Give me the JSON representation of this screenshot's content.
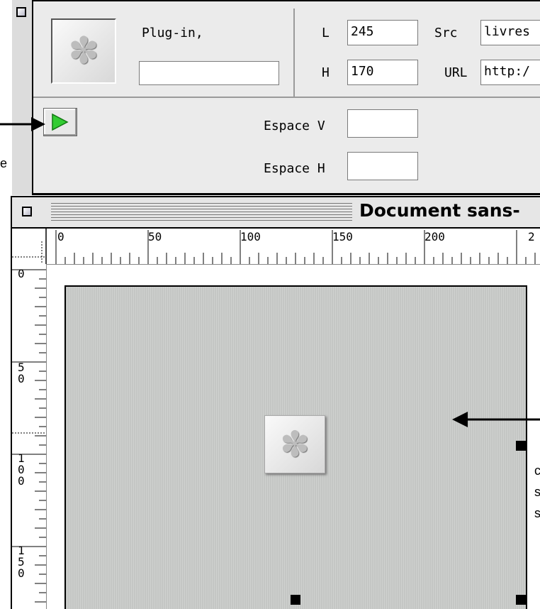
{
  "inspector": {
    "type_label": "Plug-in,",
    "name_value": "",
    "width_label": "L",
    "width_value": "245",
    "height_label": "H",
    "height_value": "170",
    "src_label": "Src",
    "src_value": "livres",
    "url_label": "URL",
    "url_value": "http:/",
    "vspace_label": "Espace V",
    "vspace_value": "",
    "hspace_label": "Espace H",
    "hspace_value": ""
  },
  "document": {
    "title": "Document sans-"
  },
  "rulers": {
    "horizontal": [
      "0",
      "50",
      "100",
      "150",
      "200",
      "2"
    ],
    "vertical": [
      "0",
      "5\n0",
      "1\n0\n0",
      "1\n5\n0"
    ]
  },
  "callouts": {
    "left_fragment": "e",
    "right_lines": [
      "c",
      "s",
      "s"
    ]
  },
  "colors": {
    "play_green": "#33cc33",
    "canvas_gray": "#c8cac8",
    "palette_bg": "#ebebeb"
  }
}
